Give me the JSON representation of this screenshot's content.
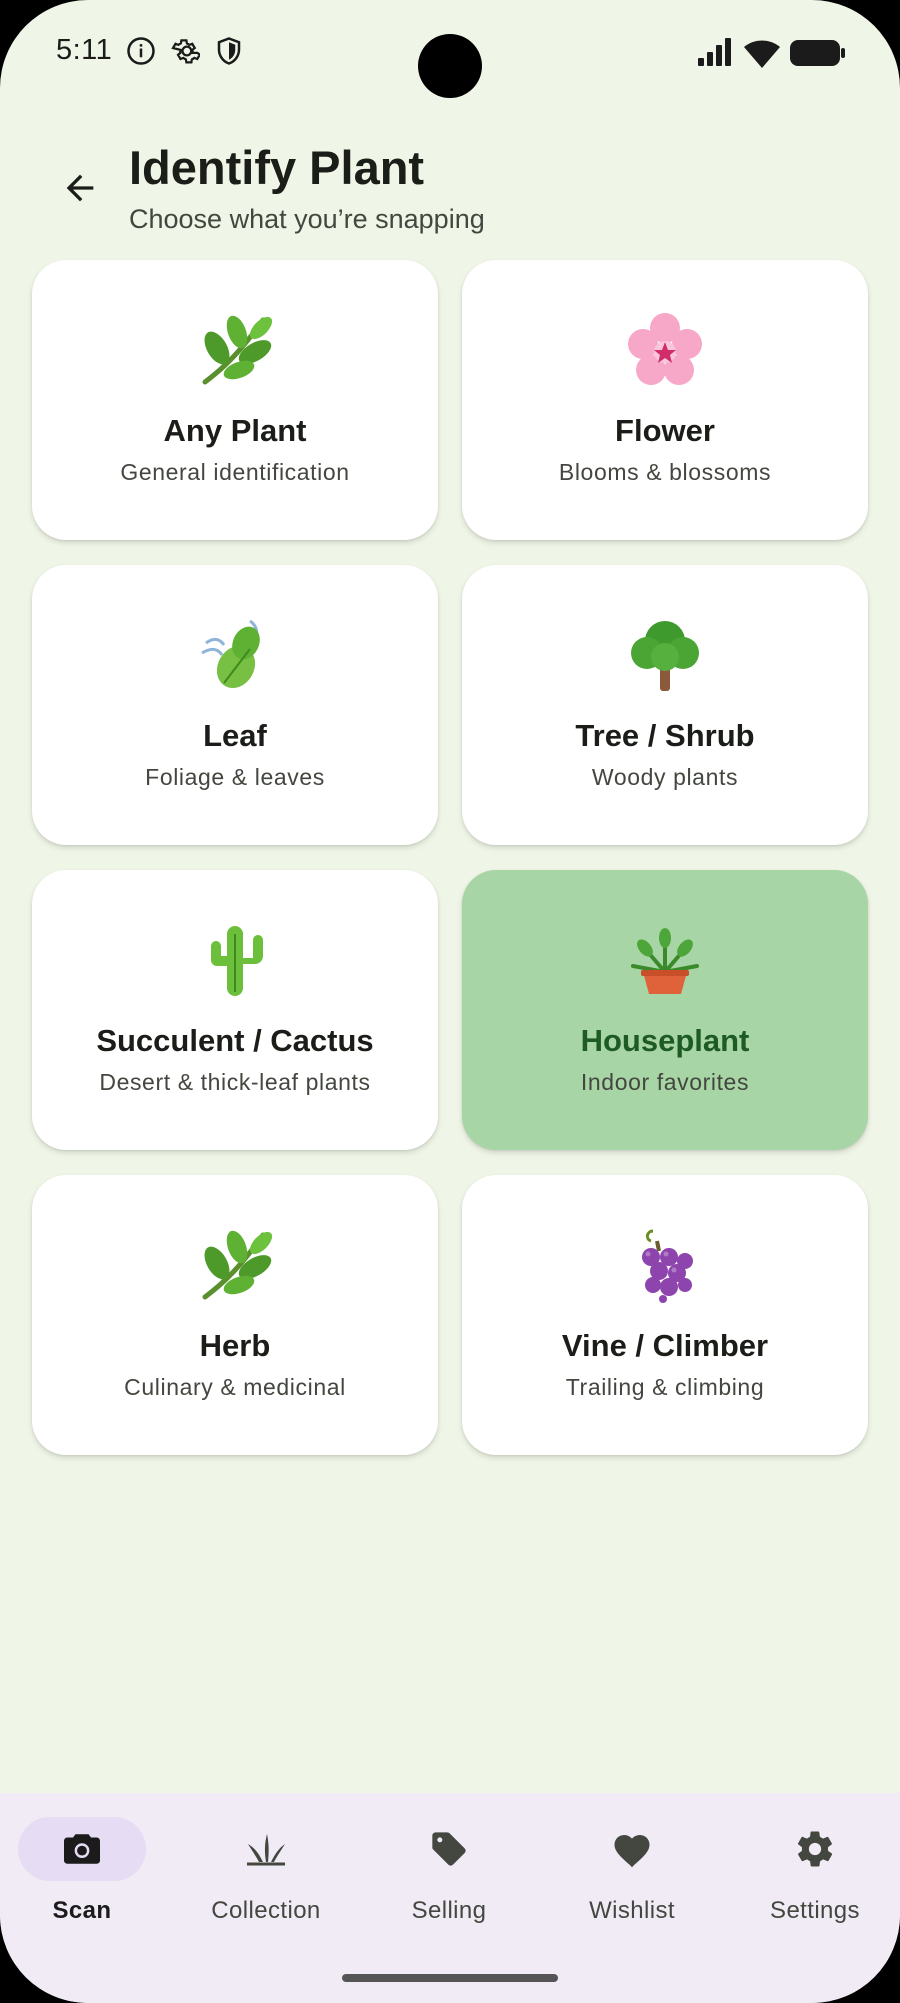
{
  "status_bar": {
    "time": "5:11",
    "icons": [
      "info-icon",
      "gear-icon",
      "shield-icon",
      "signal-icon",
      "wifi-icon",
      "battery-icon"
    ]
  },
  "header": {
    "title": "Identify Plant",
    "subtitle": "Choose what you’re snapping",
    "back_icon": "arrow-back-icon"
  },
  "categories": [
    {
      "title": "Any Plant",
      "desc": "General identification",
      "icon": "herb-icon",
      "selected": false
    },
    {
      "title": "Flower",
      "desc": "Blooms & blossoms",
      "icon": "cherry-blossom-icon",
      "selected": false
    },
    {
      "title": "Leaf",
      "desc": "Foliage & leaves",
      "icon": "fluttering-leaf-icon",
      "selected": false
    },
    {
      "title": "Tree / Shrub",
      "desc": "Woody plants",
      "icon": "tree-icon",
      "selected": false
    },
    {
      "title": "Succulent / Cactus",
      "desc": "Desert & thick-leaf plants",
      "icon": "cactus-icon",
      "selected": false
    },
    {
      "title": "Houseplant",
      "desc": "Indoor favorites",
      "icon": "potted-plant-icon",
      "selected": true
    },
    {
      "title": "Herb",
      "desc": "Culinary & medicinal",
      "icon": "herb-icon",
      "selected": false
    },
    {
      "title": "Vine / Climber",
      "desc": "Trailing & climbing",
      "icon": "grapes-icon",
      "selected": false
    }
  ],
  "bottom_nav": [
    {
      "label": "Scan",
      "icon": "camera-icon",
      "active": true
    },
    {
      "label": "Collection",
      "icon": "grass-icon",
      "active": false
    },
    {
      "label": "Selling",
      "icon": "tag-icon",
      "active": false
    },
    {
      "label": "Wishlist",
      "icon": "heart-icon",
      "active": false
    },
    {
      "label": "Settings",
      "icon": "gear-icon",
      "active": false
    }
  ],
  "colors": {
    "background": "#f0f6e7",
    "card": "#ffffff",
    "selected_card": "#a8d5a5",
    "selected_title": "#1e5a24",
    "nav_background": "#f1ebf6",
    "nav_active_pill": "#e6dcf3"
  }
}
